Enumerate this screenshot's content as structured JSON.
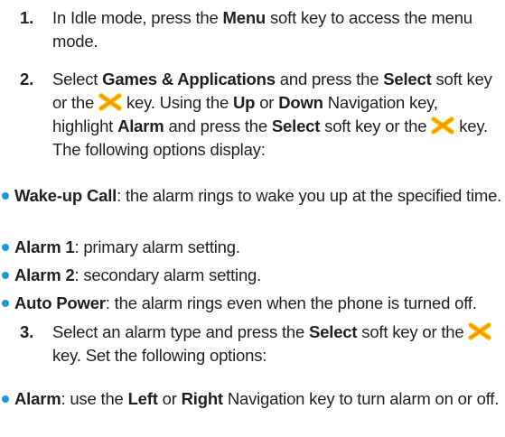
{
  "step1": {
    "number": "1.",
    "t1": "In Idle mode, press the ",
    "b1": "Menu",
    "t2": " soft key to access the menu mode."
  },
  "step2": {
    "number": "2.",
    "t1": "Select ",
    "b1": "Games & Applications",
    "t2": " and press the ",
    "b2": "Select",
    "t3": " soft key or the ",
    "t4": " key. Using the ",
    "b3": "Up",
    "t5": " or ",
    "b4": "Down",
    "t6": " Navigation key, highlight ",
    "b5": "Alarm",
    "t7": " and press the ",
    "b6": "Select",
    "t8": " soft key or the ",
    "t9": " key. The following options display:"
  },
  "bullets": [
    {
      "label": "Wake-up Call",
      "text": ": the alarm rings to wake you up at the specified time."
    },
    {
      "label": "Alarm 1",
      "text": ": primary alarm setting."
    },
    {
      "label": "Alarm 2",
      "text": ": secondary alarm setting."
    },
    {
      "label": "Auto Power",
      "text": ": the alarm rings even when the phone is turned off."
    }
  ],
  "step3": {
    "number": "3.",
    "t1": "Select an alarm type and press the ",
    "b1": "Select",
    "t2": " soft key or the ",
    "t3": " key. Set the following options:"
  },
  "alarm_bullet": {
    "label": "Alarm",
    "t1": ": use the ",
    "b1": "Left",
    "t2": " or ",
    "b2": "Right",
    "t3": " Navigation key to turn alarm on or off."
  },
  "colors": {
    "bullet": "#1a9ad9",
    "nav_key_outer": "#f4c400",
    "nav_key_inner": "#ff8a00",
    "text": "#231f20"
  },
  "icons": {
    "nav_key": "ok-navigation-key-icon"
  }
}
